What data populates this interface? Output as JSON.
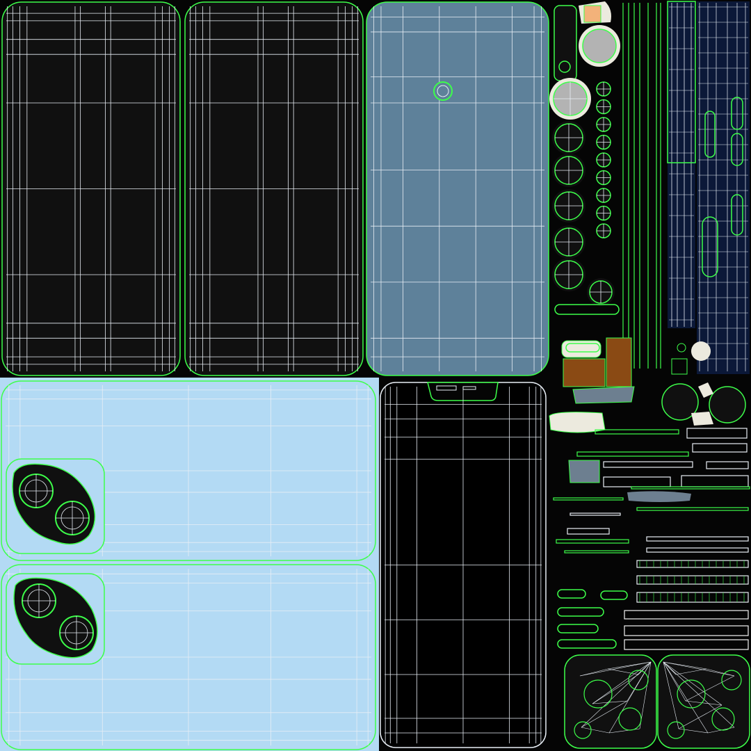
{
  "colors": {
    "background": "#050505",
    "dark_panel": "#101010",
    "light_blue_panel": "#b3daf4",
    "steel_blue_panel": "#5e819a",
    "navy_strip": "#0b1838",
    "wire_white": "#e8eef5",
    "wire_green": "#3dff4a",
    "grey_disc": "#b3b3b3",
    "cream_part": "#eceade",
    "brown_part": "#8a4a14",
    "slate_part": "#6d7f90",
    "white_bar": "#f2f2f2"
  },
  "islands": [
    {
      "name": "back-panel-left",
      "kind": "panel",
      "color": "dark_panel"
    },
    {
      "name": "back-panel-right",
      "kind": "panel",
      "color": "dark_panel"
    },
    {
      "name": "screen-panel-blue",
      "kind": "panel",
      "color": "steel_blue_panel"
    },
    {
      "name": "rear-housing-top",
      "kind": "panel",
      "color": "light_blue_panel"
    },
    {
      "name": "rear-housing-bottom",
      "kind": "panel",
      "color": "light_blue_panel"
    },
    {
      "name": "front-display-panel",
      "kind": "panel",
      "color": "background"
    },
    {
      "name": "camera-bump-top",
      "kind": "camera",
      "color": "dark_panel"
    },
    {
      "name": "camera-bump-bottom",
      "kind": "camera",
      "color": "dark_panel"
    },
    {
      "name": "camera-lens-cap-large",
      "kind": "disc",
      "color": "grey_disc"
    },
    {
      "name": "button-strips",
      "kind": "strip",
      "color": "navy_strip"
    },
    {
      "name": "corner-pad-left",
      "kind": "pad",
      "color": "dark_panel"
    },
    {
      "name": "corner-pad-right",
      "kind": "pad",
      "color": "dark_panel"
    }
  ]
}
